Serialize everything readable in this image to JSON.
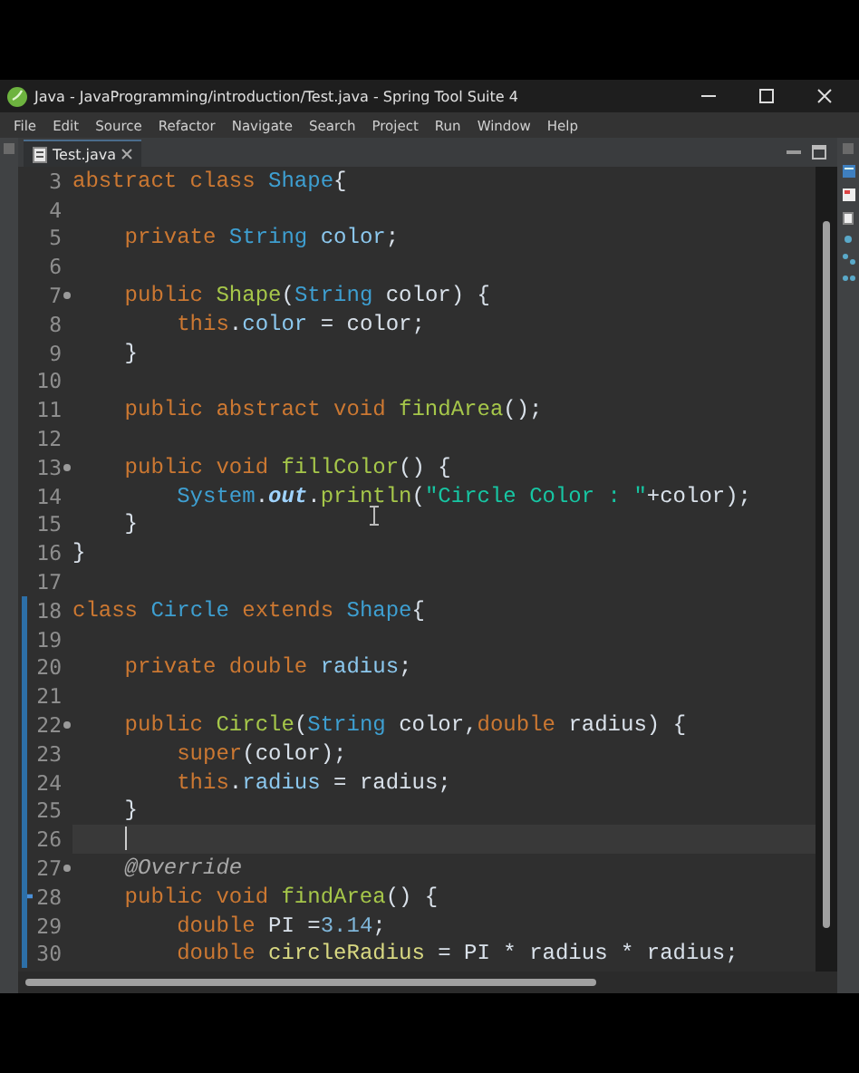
{
  "window": {
    "title": "Java - JavaProgramming/introduction/Test.java - Spring Tool Suite 4"
  },
  "menu": [
    "File",
    "Edit",
    "Source",
    "Refactor",
    "Navigate",
    "Search",
    "Project",
    "Run",
    "Window",
    "Help"
  ],
  "tabs": [
    {
      "label": "Test.java",
      "selected": true
    }
  ],
  "editor": {
    "lines": [
      {
        "number": "3",
        "fold": false,
        "changed": false,
        "current": false,
        "tokens": [
          {
            "kind": "kw",
            "text": "abstract class "
          },
          {
            "kind": "type",
            "text": "Shape"
          },
          {
            "kind": "plain",
            "text": "{"
          }
        ]
      },
      {
        "number": "4",
        "fold": false,
        "changed": false,
        "current": false
      },
      {
        "number": "5",
        "fold": false,
        "changed": false,
        "current": false,
        "tokens": [
          {
            "kind": "kw",
            "text": "    private "
          },
          {
            "kind": "type",
            "text": "String "
          },
          {
            "kind": "field",
            "text": "color"
          },
          {
            "kind": "plain",
            "text": ";"
          }
        ]
      },
      {
        "number": "6",
        "fold": false,
        "changed": false,
        "current": false
      },
      {
        "number": "7",
        "fold": true,
        "changed": false,
        "current": false,
        "tokens": [
          {
            "kind": "kw",
            "text": "    public "
          },
          {
            "kind": "fn",
            "text": "Shape"
          },
          {
            "kind": "plain",
            "text": "("
          },
          {
            "kind": "type",
            "text": "String "
          },
          {
            "kind": "plain",
            "text": "color) {"
          }
        ]
      },
      {
        "number": "8",
        "fold": false,
        "changed": false,
        "current": false,
        "tokens": [
          {
            "kind": "kw",
            "text": "        this"
          },
          {
            "kind": "plain",
            "text": "."
          },
          {
            "kind": "field",
            "text": "color"
          },
          {
            "kind": "plain",
            "text": " = color;"
          }
        ]
      },
      {
        "number": "9",
        "fold": false,
        "changed": false,
        "current": false,
        "tokens": [
          {
            "kind": "plain",
            "text": "    }"
          }
        ]
      },
      {
        "number": "10",
        "fold": false,
        "changed": false,
        "current": false
      },
      {
        "number": "11",
        "fold": false,
        "changed": false,
        "current": false,
        "tokens": [
          {
            "kind": "kw",
            "text": "    public abstract void "
          },
          {
            "kind": "fn",
            "text": "findArea"
          },
          {
            "kind": "plain",
            "text": "();"
          }
        ]
      },
      {
        "number": "12",
        "fold": false,
        "changed": false,
        "current": false
      },
      {
        "number": "13",
        "fold": true,
        "changed": false,
        "current": false,
        "tokens": [
          {
            "kind": "kw",
            "text": "    public void "
          },
          {
            "kind": "fn",
            "text": "fillColor"
          },
          {
            "kind": "plain",
            "text": "() {"
          }
        ]
      },
      {
        "number": "14",
        "fold": false,
        "changed": false,
        "current": false,
        "tokens": [
          {
            "kind": "type",
            "text": "        System"
          },
          {
            "kind": "plain",
            "text": "."
          },
          {
            "kind": "static",
            "text": "out"
          },
          {
            "kind": "plain",
            "text": "."
          },
          {
            "kind": "fn",
            "text": "println"
          },
          {
            "kind": "plain",
            "text": "("
          },
          {
            "kind": "str",
            "text": "\"Circle Color : \""
          },
          {
            "kind": "plain",
            "text": "+color);"
          }
        ]
      },
      {
        "number": "15",
        "fold": false,
        "changed": false,
        "current": false,
        "tokens": [
          {
            "kind": "plain",
            "text": "    }"
          }
        ]
      },
      {
        "number": "16",
        "fold": false,
        "changed": false,
        "current": false,
        "tokens": [
          {
            "kind": "plain",
            "text": "}"
          }
        ]
      },
      {
        "number": "17",
        "fold": false,
        "changed": false,
        "current": false
      },
      {
        "number": "18",
        "fold": false,
        "changed": true,
        "current": false,
        "tokens": [
          {
            "kind": "kw",
            "text": "class "
          },
          {
            "kind": "type",
            "text": "Circle "
          },
          {
            "kind": "kw",
            "text": "extends "
          },
          {
            "kind": "type",
            "text": "Shape"
          },
          {
            "kind": "plain",
            "text": "{"
          }
        ]
      },
      {
        "number": "19",
        "fold": false,
        "changed": true,
        "current": false
      },
      {
        "number": "20",
        "fold": false,
        "changed": true,
        "current": false,
        "tokens": [
          {
            "kind": "kw",
            "text": "    private double "
          },
          {
            "kind": "field",
            "text": "radius"
          },
          {
            "kind": "plain",
            "text": ";"
          }
        ]
      },
      {
        "number": "21",
        "fold": false,
        "changed": true,
        "current": false
      },
      {
        "number": "22",
        "fold": true,
        "changed": true,
        "current": false,
        "tokens": [
          {
            "kind": "kw",
            "text": "    public "
          },
          {
            "kind": "fn",
            "text": "Circle"
          },
          {
            "kind": "plain",
            "text": "("
          },
          {
            "kind": "type",
            "text": "String "
          },
          {
            "kind": "plain",
            "text": "color,"
          },
          {
            "kind": "kw",
            "text": "double "
          },
          {
            "kind": "plain",
            "text": "radius) {"
          }
        ]
      },
      {
        "number": "23",
        "fold": false,
        "changed": true,
        "current": false,
        "tokens": [
          {
            "kind": "kw",
            "text": "        super"
          },
          {
            "kind": "plain",
            "text": "(color);"
          }
        ]
      },
      {
        "number": "24",
        "fold": false,
        "changed": true,
        "current": false,
        "tokens": [
          {
            "kind": "kw",
            "text": "        this"
          },
          {
            "kind": "plain",
            "text": "."
          },
          {
            "kind": "field",
            "text": "radius"
          },
          {
            "kind": "plain",
            "text": " = radius;"
          }
        ]
      },
      {
        "number": "25",
        "fold": false,
        "changed": true,
        "current": false,
        "tokens": [
          {
            "kind": "plain",
            "text": "    }"
          }
        ]
      },
      {
        "number": "26",
        "fold": false,
        "changed": true,
        "current": true
      },
      {
        "number": "27",
        "fold": true,
        "changed": true,
        "current": false,
        "tokens": [
          {
            "kind": "ann",
            "text": "    @Override"
          }
        ]
      },
      {
        "number": "28",
        "fold": false,
        "changed": true,
        "current": false,
        "overrides": true,
        "tokens": [
          {
            "kind": "kw",
            "text": "    public void "
          },
          {
            "kind": "fn",
            "text": "findArea"
          },
          {
            "kind": "plain",
            "text": "() {"
          }
        ]
      },
      {
        "number": "29",
        "fold": false,
        "changed": true,
        "current": false,
        "tokens": [
          {
            "kind": "kw",
            "text": "        double "
          },
          {
            "kind": "plain",
            "text": "PI ="
          },
          {
            "kind": "num",
            "text": "3.14"
          },
          {
            "kind": "plain",
            "text": ";"
          }
        ]
      },
      {
        "number": "30",
        "fold": false,
        "changed": true,
        "current": false,
        "tokens": [
          {
            "kind": "kw",
            "text": "        double "
          },
          {
            "kind": "local",
            "text": "circleRadius"
          },
          {
            "kind": "plain",
            "text": " = PI * radius * radius;"
          }
        ]
      }
    ]
  }
}
